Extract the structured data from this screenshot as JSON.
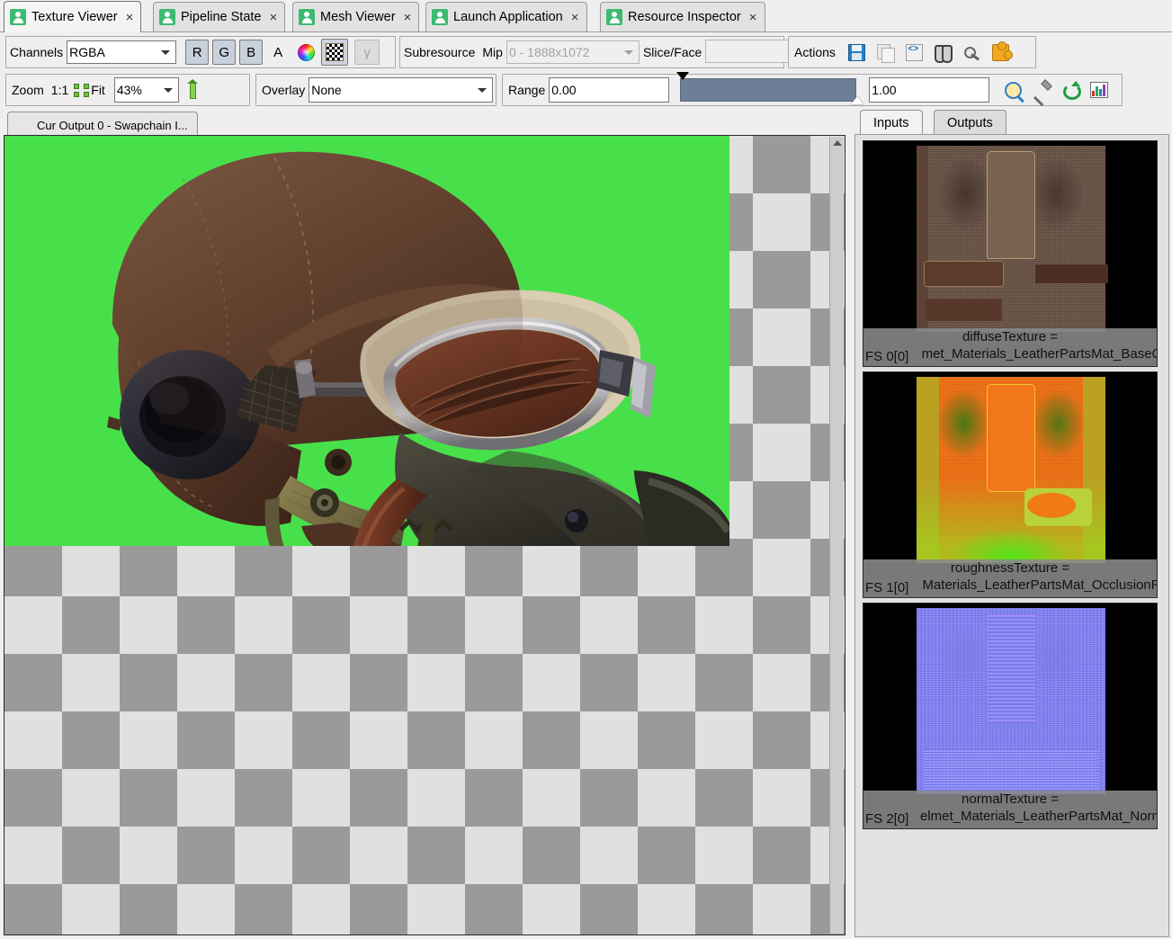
{
  "window": {
    "tabs": [
      {
        "label": "Texture Viewer",
        "icon": "person-icon",
        "active": true,
        "close": "×"
      },
      {
        "label": "Pipeline State",
        "icon": "person-icon",
        "active": false,
        "close": "×"
      },
      {
        "label": "Mesh Viewer",
        "icon": "person-icon",
        "active": false,
        "close": "×"
      },
      {
        "label": "Launch Application",
        "icon": "person-icon",
        "active": false,
        "close": "×"
      },
      {
        "label": "Resource Inspector",
        "icon": "person-icon",
        "active": false,
        "close": "×"
      }
    ]
  },
  "toolbar": {
    "channels_label": "Channels",
    "channels_value": "RGBA",
    "channel_buttons": [
      {
        "label": "R",
        "pressed": true
      },
      {
        "label": "G",
        "pressed": true
      },
      {
        "label": "B",
        "pressed": true
      },
      {
        "label": "A",
        "pressed": false
      }
    ],
    "color_wheel_icon": "color-wheel-icon",
    "checker_icon": "checkerboard-icon",
    "gamma_label": "γ",
    "subresource_label": "Subresource",
    "mip_label": "Mip",
    "mip_value": "0 - 1888x1072",
    "slice_label": "Slice/Face",
    "slice_value": "",
    "actions_label": "Actions",
    "action_icons": [
      "save-icon",
      "copy-icon",
      "open-shader-icon",
      "find-icon",
      "pin-icon",
      "plugin-icon"
    ]
  },
  "zoomrow": {
    "zoom_label": "Zoom",
    "one_to_one": "1:1",
    "fit_label": "Fit",
    "zoom_value": "43%",
    "flip_icon": "flip-y-icon",
    "overlay_label": "Overlay",
    "overlay_value": "None",
    "range_label": "Range",
    "range_min": "0.00",
    "range_max": "1.00",
    "range_icons": [
      "autofit-range-icon",
      "picker-icon",
      "reset-range-icon",
      "histogram-icon"
    ]
  },
  "texture_tab": {
    "label": "Cur Output 0 - Swapchain I...",
    "icon": "person-icon"
  },
  "right_panel": {
    "tabs": [
      {
        "label": "Inputs",
        "active": true
      },
      {
        "label": "Outputs",
        "active": false
      }
    ],
    "thumbnails": [
      {
        "slot": "FS 0[0]",
        "name": "diffuseTexture =",
        "resource": "met_Materials_LeatherPartsMat_BaseC",
        "kind": "diffuse"
      },
      {
        "slot": "FS 1[0]",
        "name": "roughnessTexture =",
        "resource": "Materials_LeatherPartsMat_OcclusionR",
        "kind": "roughness"
      },
      {
        "slot": "FS 2[0]",
        "name": "normalTexture =",
        "resource": "elmet_Materials_LeatherPartsMat_Norm",
        "kind": "normal"
      }
    ]
  },
  "viewport": {
    "background_clear_color": "#48e04a",
    "checker_light": "#e0e0e0",
    "checker_dark": "#9a9a9a",
    "content_description": "Rendered aviator leather flight helmet with goggles and oxygen mask"
  }
}
